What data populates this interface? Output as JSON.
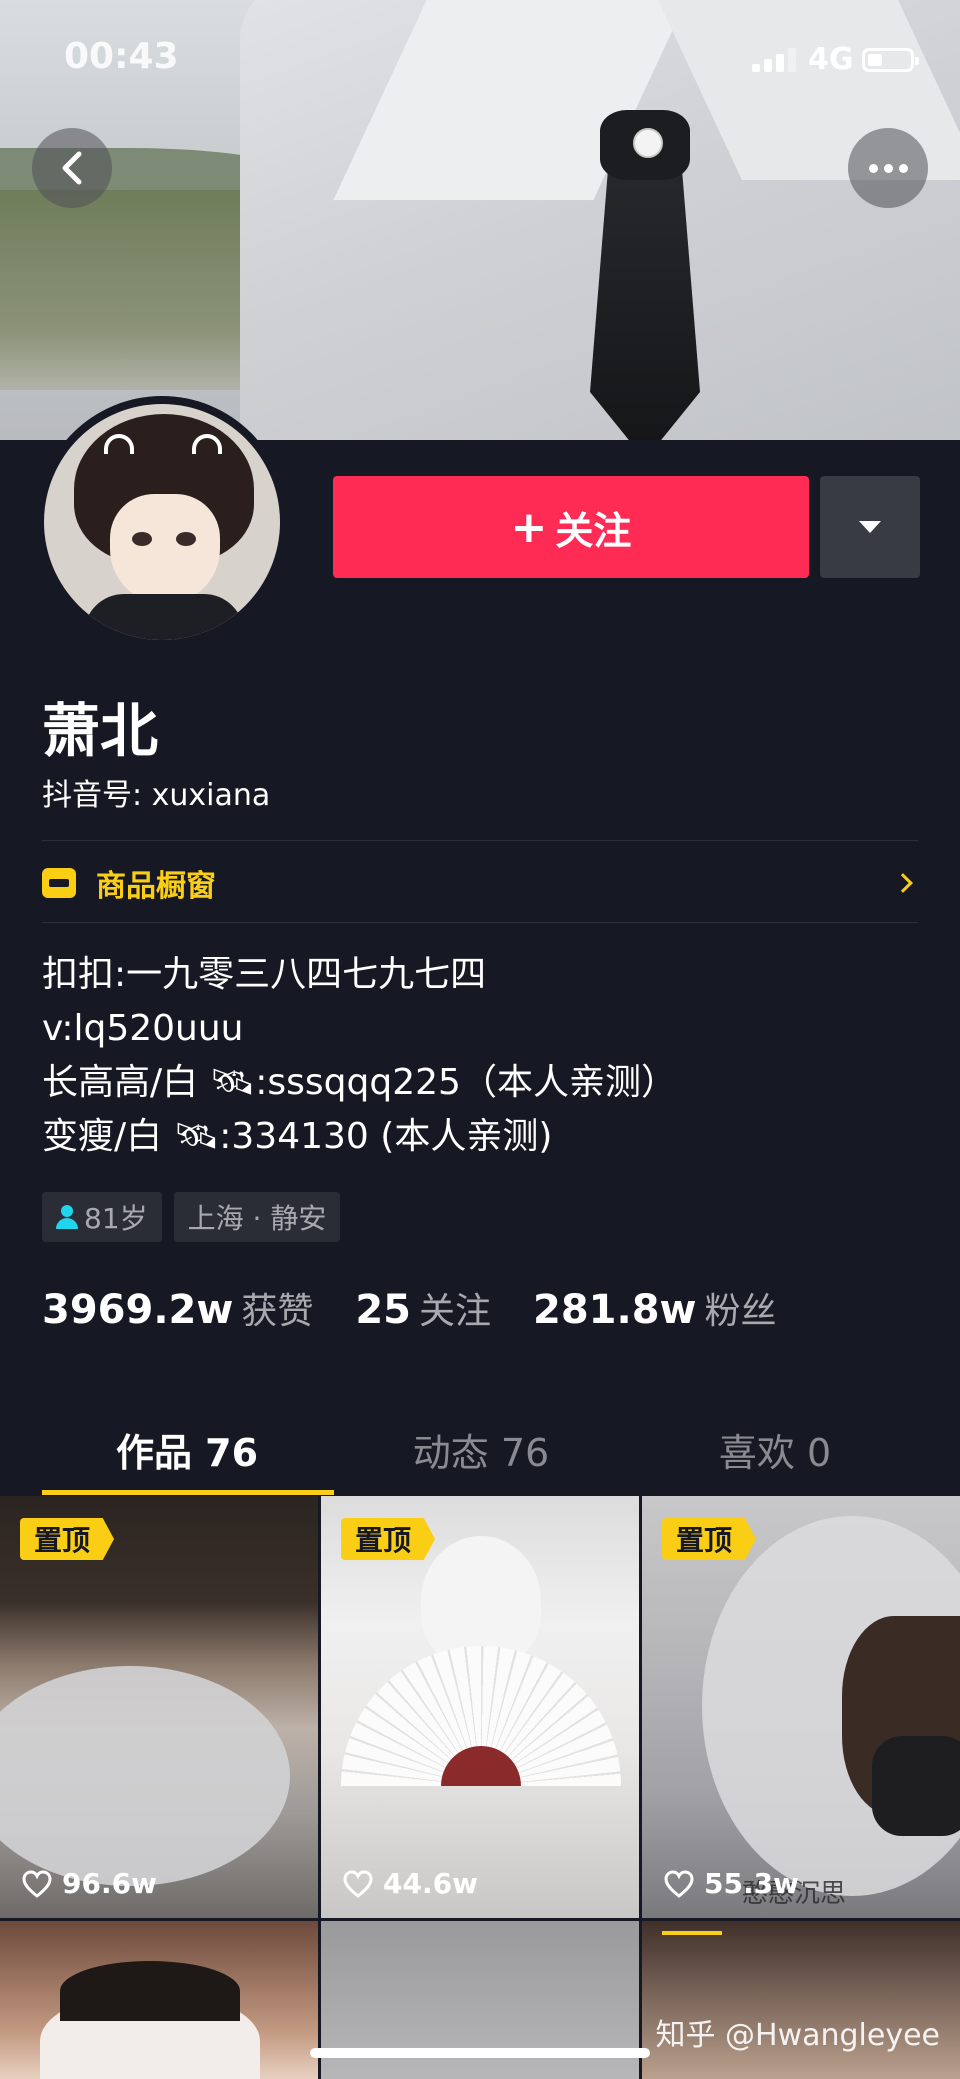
{
  "status_bar": {
    "time": "00:43",
    "network": "4G"
  },
  "profile": {
    "name": "萧北",
    "douyin_id": "抖音号: xuxiana",
    "follow_label": "关注",
    "shop_label": "商品橱窗",
    "bio": [
      "扣扣:一九零三八四七九七四",
      "v:lq520uuu",
      "长高高/白 🛰:sssqqq225（本人亲测）",
      "变瘦/白 🛰:334130 (本人亲测)"
    ],
    "tags": {
      "age": "81岁",
      "location": "上海 · 静安"
    },
    "stats": {
      "likes": {
        "num": "3969.2w",
        "label": "获赞"
      },
      "following": {
        "num": "25",
        "label": "关注"
      },
      "followers": {
        "num": "281.8w",
        "label": "粉丝"
      }
    }
  },
  "tabs": [
    {
      "label": "作品 76",
      "active": true
    },
    {
      "label": "动态 76",
      "active": false
    },
    {
      "label": "喜欢 0",
      "active": false
    }
  ],
  "videos": [
    {
      "pinned_label": "置顶",
      "likes": "96.6w"
    },
    {
      "pinned_label": "置顶",
      "likes": "44.6w"
    },
    {
      "pinned_label": "置顶",
      "likes": "55.3w",
      "caption": "憨憨沉思"
    }
  ],
  "watermark": "知乎 @Hwangleyee",
  "colors": {
    "accent": "#fe2c55",
    "highlight": "#face15",
    "background": "#161823"
  }
}
